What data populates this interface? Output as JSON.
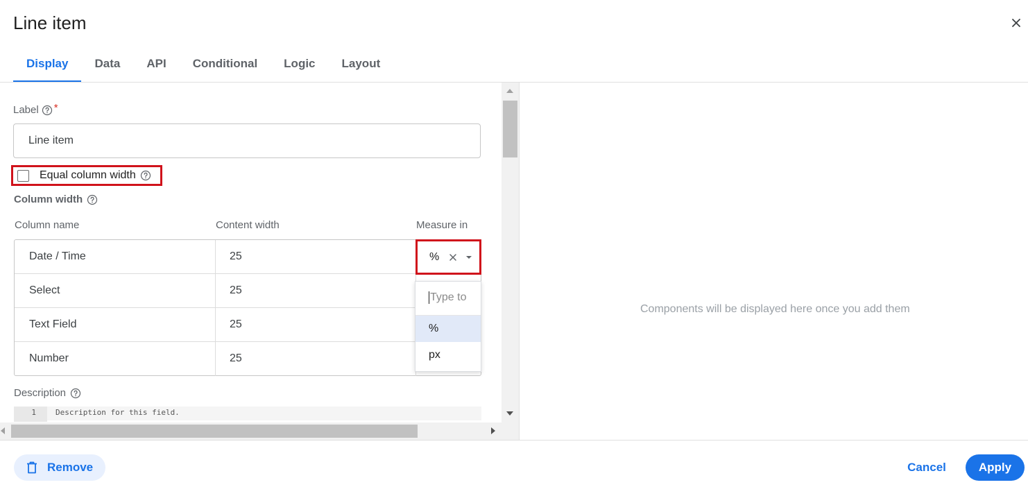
{
  "dialog": {
    "title": "Line item"
  },
  "tabs": [
    {
      "label": "Display",
      "active": true
    },
    {
      "label": "Data"
    },
    {
      "label": "API"
    },
    {
      "label": "Conditional"
    },
    {
      "label": "Logic"
    },
    {
      "label": "Layout"
    }
  ],
  "form": {
    "label_field": {
      "label": "Label",
      "required_mark": "*",
      "value": "Line item"
    },
    "equal_column_width": {
      "label": "Equal column width",
      "checked": false
    },
    "column_width": {
      "section_label": "Column width",
      "headers": {
        "name": "Column name",
        "content": "Content width",
        "measure": "Measure in"
      },
      "rows": [
        {
          "name": "Date / Time",
          "width": "25"
        },
        {
          "name": "Select",
          "width": "25"
        },
        {
          "name": "Text Field",
          "width": "25"
        },
        {
          "name": "Number",
          "width": "25"
        }
      ],
      "measure": {
        "value": "%",
        "search_placeholder": "Type to",
        "options": [
          "%",
          "px"
        ],
        "selected": "%"
      }
    },
    "description": {
      "label": "Description",
      "line_number": "1",
      "code_line": "Description for this field."
    }
  },
  "preview": {
    "empty_message": "Components will be displayed here once you add them"
  },
  "footer": {
    "remove_label": "Remove",
    "cancel_label": "Cancel",
    "apply_label": "Apply"
  },
  "colors": {
    "accent": "#1a73e8",
    "highlight_border": "#d0121b",
    "selected_option_bg": "#e1e9f8"
  }
}
